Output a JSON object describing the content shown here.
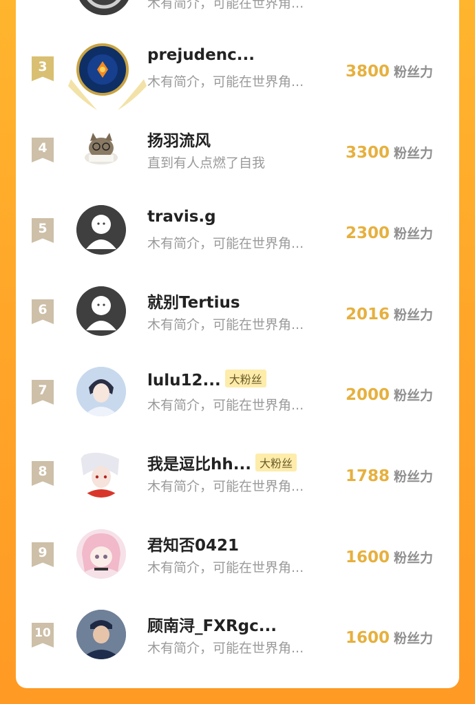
{
  "top_partial": {
    "bio": "木有简介，可能在世界角..."
  },
  "unit_label": "粉丝力",
  "rows": [
    {
      "rank": "3",
      "name": "prejudenc...",
      "bio": "木有简介，可能在世界角...",
      "score": "3800",
      "badge": "",
      "avatar": "crest-avatar-icon"
    },
    {
      "rank": "4",
      "name": "扬羽流风",
      "bio": "直到有人点燃了自我",
      "score": "3300",
      "badge": "",
      "avatar": "cat-reading-avatar-icon"
    },
    {
      "rank": "5",
      "name": "travis.g",
      "bio": "木有简介，可能在世界角...",
      "score": "2300",
      "badge": "",
      "avatar": "default-avatar-icon"
    },
    {
      "rank": "6",
      "name": "就别Tertius",
      "bio": "木有简介，可能在世界角...",
      "score": "2016",
      "badge": "",
      "avatar": "default-avatar-icon"
    },
    {
      "rank": "7",
      "name": "lulu12...",
      "bio": "木有简介，可能在世界角...",
      "score": "2000",
      "badge": "大粉丝",
      "avatar": "anime-boy-avatar-icon"
    },
    {
      "rank": "8",
      "name": "我是逗比hh...",
      "bio": "木有简介，可能在世界角...",
      "score": "1788",
      "badge": "大粉丝",
      "avatar": "white-hair-anime-avatar-icon"
    },
    {
      "rank": "9",
      "name": "君知否0421",
      "bio": "木有简介，可能在世界角...",
      "score": "1600",
      "badge": "",
      "avatar": "pink-hair-anime-avatar-icon"
    },
    {
      "rank": "10",
      "name": "顾南浔_FXRgc...",
      "bio": "木有简介，可能在世界角...",
      "score": "1600",
      "badge": "",
      "avatar": "photo-boy-avatar-icon"
    }
  ]
}
